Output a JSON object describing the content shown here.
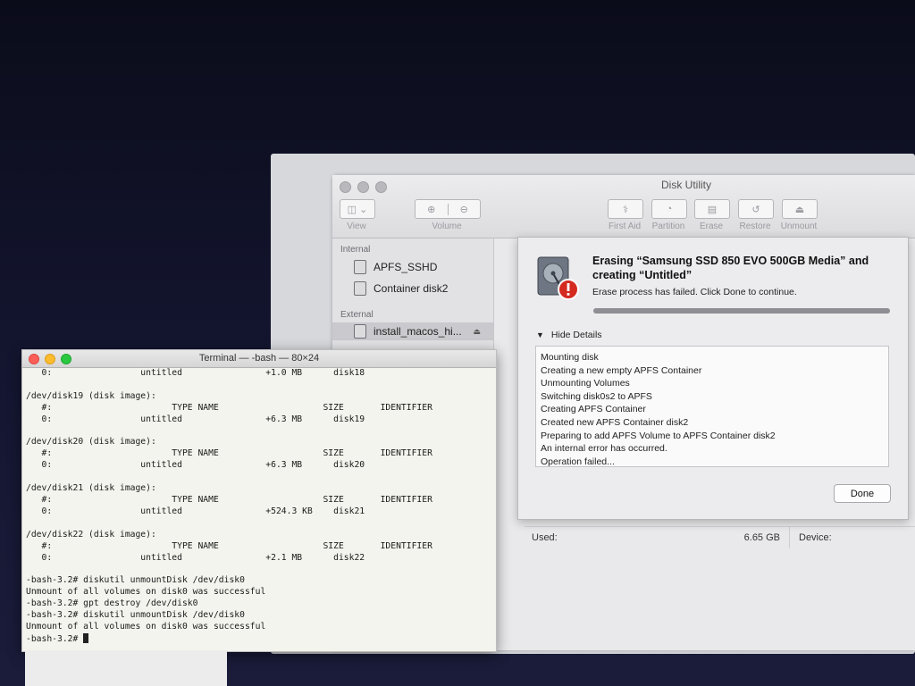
{
  "disk_utility": {
    "title": "Disk Utility",
    "toolbar": {
      "view_label": "View",
      "volume_label": "Volume",
      "first_aid_label": "First Aid",
      "partition_label": "Partition",
      "erase_label": "Erase",
      "restore_label": "Restore",
      "unmount_label": "Unmount"
    },
    "sidebar": {
      "internal_header": "Internal",
      "external_header": "External",
      "items": [
        {
          "label": "APFS_SSHD"
        },
        {
          "label": "Container disk2"
        },
        {
          "label": "install_macos_hi..."
        }
      ]
    },
    "info": {
      "used_label": "Used:",
      "used_value": "6.65 GB",
      "device_label": "Device:"
    },
    "sheet": {
      "title": "Erasing “Samsung SSD 850 EVO 500GB Media” and creating “Untitled”",
      "subtitle": "Erase process has failed. Click Done to continue.",
      "progress": 1.0,
      "toggle_label": "Hide Details",
      "log": [
        "Mounting disk",
        "Creating a new empty APFS Container",
        "Unmounting Volumes",
        "Switching disk0s2 to APFS",
        "Creating APFS Container",
        "Created new APFS Container disk2",
        "Preparing to add APFS Volume to APFS Container disk2",
        "An internal error has occurred.",
        "Operation failed..."
      ],
      "done_label": "Done"
    }
  },
  "terminal": {
    "title": "Terminal — -bash — 80×24",
    "lines": [
      "   0:                 untitled                +1.0 MB      disk18",
      "",
      "/dev/disk19 (disk image):",
      "   #:                       TYPE NAME                    SIZE       IDENTIFIER",
      "   0:                 untitled                +6.3 MB      disk19",
      "",
      "/dev/disk20 (disk image):",
      "   #:                       TYPE NAME                    SIZE       IDENTIFIER",
      "   0:                 untitled                +6.3 MB      disk20",
      "",
      "/dev/disk21 (disk image):",
      "   #:                       TYPE NAME                    SIZE       IDENTIFIER",
      "   0:                 untitled                +524.3 KB    disk21",
      "",
      "/dev/disk22 (disk image):",
      "   #:                       TYPE NAME                    SIZE       IDENTIFIER",
      "   0:                 untitled                +2.1 MB      disk22",
      "",
      "-bash-3.2# diskutil unmountDisk /dev/disk0",
      "Unmount of all volumes on disk0 was successful",
      "-bash-3.2# gpt destroy /dev/disk0",
      "-bash-3.2# diskutil unmountDisk /dev/disk0",
      "Unmount of all volumes on disk0 was successful"
    ],
    "prompt": "-bash-3.2# "
  }
}
